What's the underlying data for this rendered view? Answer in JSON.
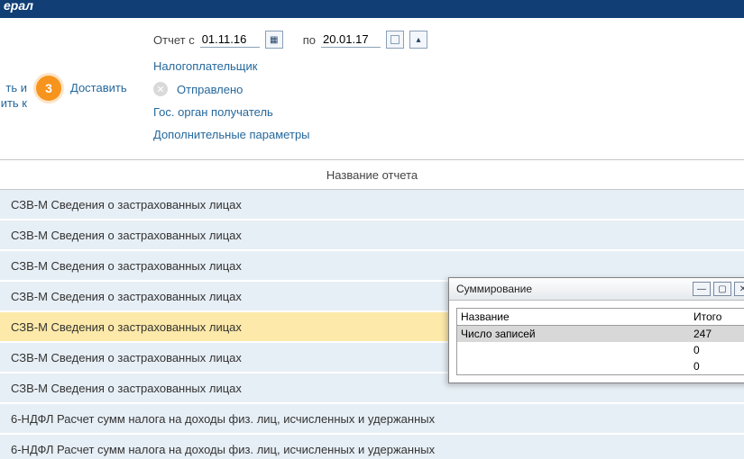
{
  "topbar": {
    "brand_fragment": "ерал"
  },
  "left_slice": {
    "line1": "ть и",
    "line2": "ить к"
  },
  "step": {
    "number": "3",
    "label": "Доставить"
  },
  "dates": {
    "from_label": "Отчет с",
    "from_value": "01.11.16",
    "to_label": "по",
    "to_value": "20.01.17"
  },
  "param_links": {
    "taxpayer": "Налогоплательщик",
    "sent": "Отправлено",
    "gov_body": "Гос. орган получатель",
    "extra": "Дополнительные параметры"
  },
  "table": {
    "header": "Название отчета",
    "rows": [
      {
        "title": "СЗВ-М Сведения о застрахованных лицах",
        "selected": false
      },
      {
        "title": "СЗВ-М Сведения о застрахованных лицах",
        "selected": false
      },
      {
        "title": "СЗВ-М Сведения о застрахованных лицах",
        "selected": false
      },
      {
        "title": "СЗВ-М Сведения о застрахованных лицах",
        "selected": false
      },
      {
        "title": "СЗВ-М Сведения о застрахованных лицах",
        "selected": true
      },
      {
        "title": "СЗВ-М Сведения о застрахованных лицах",
        "selected": false
      },
      {
        "title": "СЗВ-М Сведения о застрахованных лицах",
        "selected": false
      },
      {
        "title": "6-НДФЛ Расчет сумм налога на доходы физ. лиц, исчисленных и удержанных",
        "selected": false
      },
      {
        "title": "6-НДФЛ Расчет сумм налога на доходы физ. лиц, исчисленных и удержанных",
        "selected": false
      }
    ]
  },
  "sum_window": {
    "title": "Суммирование",
    "col_name": "Название",
    "col_total": "Итого",
    "rows": [
      {
        "name": "Число записей",
        "total": "247",
        "selected": true
      },
      {
        "name": "",
        "total": "0",
        "selected": false
      },
      {
        "name": "",
        "total": "0",
        "selected": false
      }
    ]
  }
}
